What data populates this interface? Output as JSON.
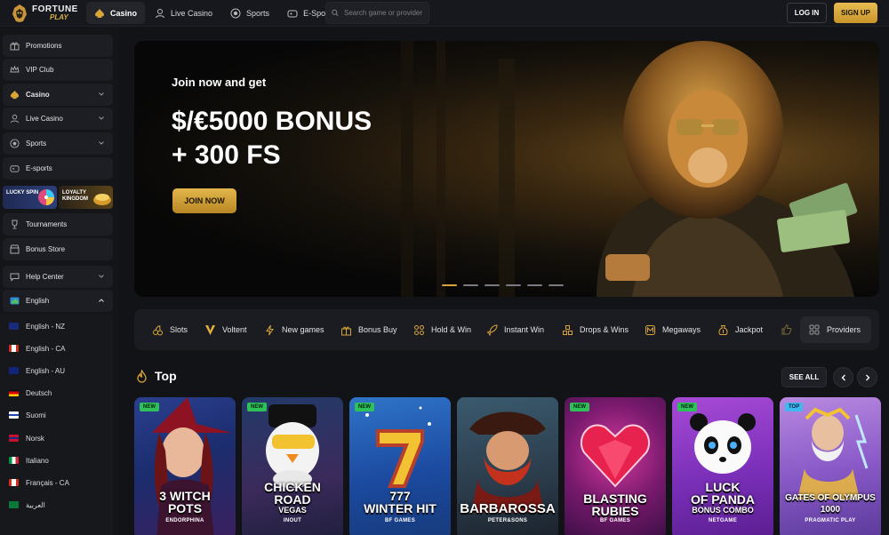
{
  "brand": {
    "name_top": "FORTUNE",
    "name_bottom": "PLAY"
  },
  "topnav": [
    {
      "label": "Casino",
      "icon": "spade-icon",
      "active": true
    },
    {
      "label": "Live Casino",
      "icon": "dealer-icon"
    },
    {
      "label": "Sports",
      "icon": "soccer-ball-icon"
    },
    {
      "label": "E-Sports",
      "icon": "gamepad-icon"
    }
  ],
  "search": {
    "placeholder": "Search game or provider"
  },
  "auth": {
    "login": "LOG IN",
    "signup": "SIGN UP"
  },
  "sidebar": {
    "items": [
      {
        "label": "Promotions",
        "icon": "gift-icon"
      },
      {
        "label": "VIP Club",
        "icon": "crown-icon"
      },
      {
        "label": "Casino",
        "icon": "spade-icon",
        "expandable": true,
        "active": true
      },
      {
        "label": "Live Casino",
        "icon": "dealer-icon",
        "expandable": true
      },
      {
        "label": "Sports",
        "icon": "soccer-ball-icon",
        "expandable": true
      },
      {
        "label": "E-sports",
        "icon": "gamepad-icon"
      }
    ],
    "promos": [
      {
        "label": "LUCKY SPIN"
      },
      {
        "label": "LOYALTY KINGDOM"
      }
    ],
    "items2": [
      {
        "label": "Tournaments",
        "icon": "trophy-icon"
      },
      {
        "label": "Bonus Store",
        "icon": "store-icon"
      },
      {
        "label": "Help Center",
        "icon": "chat-icon",
        "expandable": true
      },
      {
        "label": "English",
        "icon": "globe-icon",
        "expanded": true
      }
    ],
    "languages": [
      {
        "label": "English - NZ",
        "flag": "nz"
      },
      {
        "label": "English - CA",
        "flag": "ca"
      },
      {
        "label": "English - AU",
        "flag": "au"
      },
      {
        "label": "Deutsch",
        "flag": "de"
      },
      {
        "label": "Suomi",
        "flag": "fi"
      },
      {
        "label": "Norsk",
        "flag": "no"
      },
      {
        "label": "Italiano",
        "flag": "it"
      },
      {
        "label": "Français - CA",
        "flag": "ca"
      },
      {
        "label": "العربية",
        "flag": "sa"
      }
    ]
  },
  "hero": {
    "subtitle": "Join now and get",
    "title_line1": "$/€5000 BONUS",
    "title_line2": "+ 300 FS",
    "cta": "JOIN NOW",
    "slides": 6,
    "active_slide": 0
  },
  "categories": [
    {
      "label": "Slots",
      "icon": "cherries-icon"
    },
    {
      "label": "Voltent",
      "icon": "voltent-v-icon"
    },
    {
      "label": "New games",
      "icon": "lightning-icon"
    },
    {
      "label": "Bonus Buy",
      "icon": "bonus-box-icon"
    },
    {
      "label": "Hold & Win",
      "icon": "coins-icon"
    },
    {
      "label": "Instant Win",
      "icon": "rocket-icon"
    },
    {
      "label": "Drops & Wins",
      "icon": "stack-icon"
    },
    {
      "label": "Megaways",
      "icon": "megaways-icon"
    },
    {
      "label": "Jackpot",
      "icon": "moneybag-icon"
    }
  ],
  "providers_label": "Providers",
  "top": {
    "title": "Top",
    "see_all": "SEE ALL",
    "games": [
      {
        "title": "3 WITCH\nPOTS",
        "provider": "ENDORPHINA",
        "badge": "NEW"
      },
      {
        "title": "CHICKEN\nROAD",
        "sub": "VEGAS",
        "provider": "INOUT",
        "badge": "NEW"
      },
      {
        "title": "777\nWINTER HIT",
        "provider": "BF GAMES",
        "badge": "NEW"
      },
      {
        "title": "BARBAROSSA",
        "provider": "PETER&SONS",
        "badge": ""
      },
      {
        "title": "BLASTING\nRUBIES",
        "provider": "BF GAMES",
        "badge": "NEW"
      },
      {
        "title": "LUCK\nOF PANDA",
        "sub": "BONUS COMBO",
        "provider": "NETGAME",
        "badge": "NEW"
      },
      {
        "title": "GATES OF OLYMPUS\n1000",
        "provider": "PRAGMATIC PLAY",
        "badge": "TOP"
      }
    ]
  },
  "colors": {
    "accent": "#d9a63c",
    "bg": "#121317",
    "panel": "#1d1e23",
    "new_badge": "#2ec15a",
    "top_badge": "#3fb8f0"
  }
}
